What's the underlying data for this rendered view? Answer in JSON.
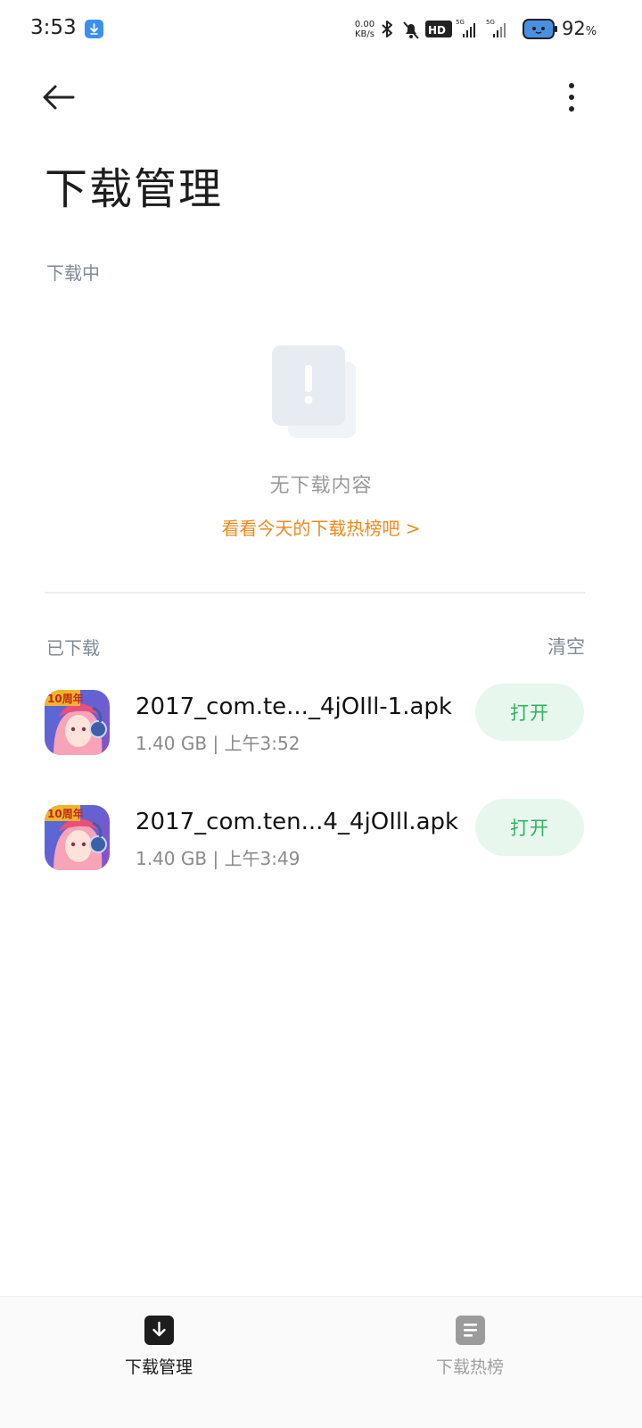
{
  "status_bar": {
    "time": "3:53",
    "net_speed_value": "0.00",
    "net_speed_unit": "KB/s",
    "network_badge": "HD",
    "signal_1_label": "5G",
    "signal_2_label": "5G",
    "battery_percent": "92",
    "battery_unit": "%"
  },
  "header": {
    "title": "下载管理"
  },
  "downloading": {
    "section_label": "下载中",
    "empty_text": "无下载内容",
    "hot_link": "看看今天的下载热榜吧 >"
  },
  "downloaded": {
    "section_label": "已下载",
    "clear_label": "清空",
    "items": [
      {
        "name": "2017_com.te..._4jOIll-1.apk",
        "meta": "1.40 GB | 上午3:52",
        "action": "打开",
        "icon_badge": "10周年"
      },
      {
        "name": "2017_com.ten...4_4jOIll.apk",
        "meta": "1.40 GB | 上午3:49",
        "action": "打开",
        "icon_badge": "10周年"
      }
    ]
  },
  "bottom_nav": {
    "items": [
      {
        "label": "下载管理",
        "icon": "download-manage-icon",
        "active": true
      },
      {
        "label": "下载热榜",
        "icon": "hot-list-icon",
        "active": false
      }
    ]
  },
  "colors": {
    "accent_orange": "#ee8a1f",
    "open_button_text": "#2fb35e",
    "open_button_bg": "#e8f7ee",
    "section_label": "#7f8a96"
  }
}
